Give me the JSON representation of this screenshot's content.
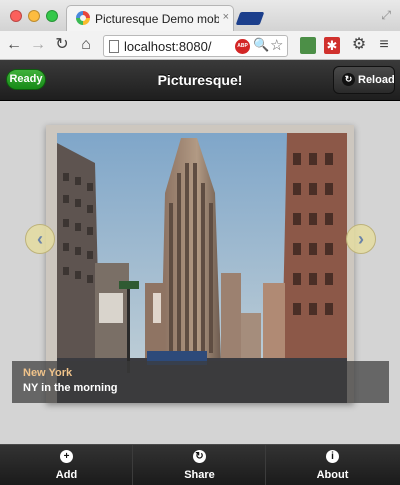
{
  "browser": {
    "tab_title": "Picturesque Demo mobile",
    "tab_close": "×",
    "url": "localhost:8080/",
    "adblock_label": "ABP",
    "fullscreen_glyph": "⤢",
    "nav": {
      "back": "←",
      "forward": "→",
      "reload": "↻",
      "home": "⌂"
    },
    "search_glyph": "🔍",
    "star_glyph": "☆",
    "ext2_glyph": "✱",
    "settings_glyph": "⚙",
    "menu_glyph": "≡"
  },
  "header": {
    "status": "Ready",
    "title": "Picturesque!",
    "reload_label": "Reload",
    "reload_icon": "↻"
  },
  "gallery": {
    "prev_glyph": "‹",
    "next_glyph": "›",
    "caption_title": "New York",
    "caption_subtitle": "NY in the morning"
  },
  "tabs": [
    {
      "label": "Add",
      "icon": "+"
    },
    {
      "label": "Share",
      "icon": "↻"
    },
    {
      "label": "About",
      "icon": "i"
    }
  ],
  "colors": {
    "status_green": "#1f9a1f",
    "caption_title": "#f0c38a",
    "header_dark": "#222222"
  }
}
